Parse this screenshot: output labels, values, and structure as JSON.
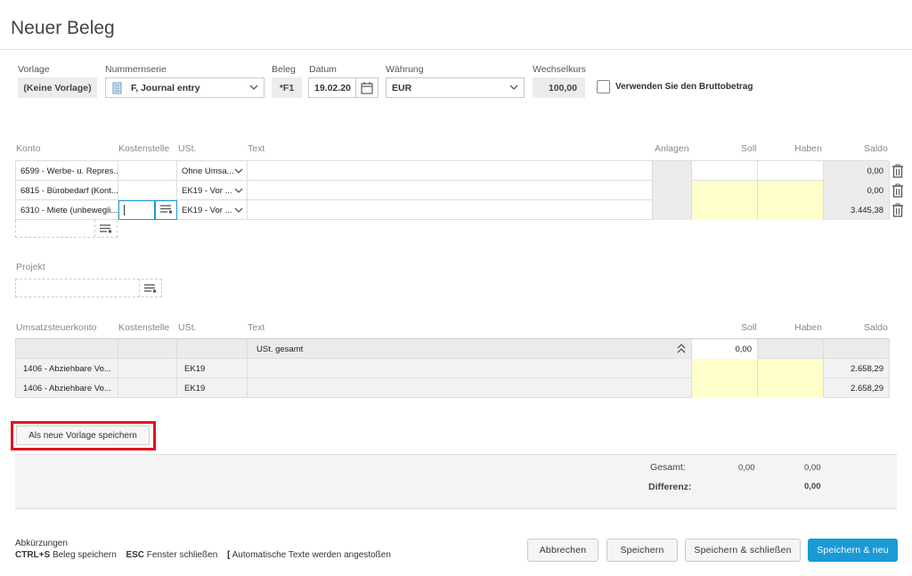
{
  "page": {
    "title": "Neuer Beleg"
  },
  "header": {
    "vorlage_label": "Vorlage",
    "vorlage_value": "(Keine Vorlage)",
    "nummernserie_label": "Nummernserie",
    "nummernserie_value": "F, Journal entry",
    "beleg_label": "Beleg",
    "beleg_value": "*F1",
    "datum_label": "Datum",
    "datum_value": "19.02.20",
    "waehrung_label": "Währung",
    "waehrung_value": "EUR",
    "wechselkurs_label": "Wechselkurs",
    "wechselkurs_value": "100,00",
    "brutto_label": "Verwenden Sie den Bruttobetrag"
  },
  "lines": {
    "columns": {
      "konto": "Konto",
      "kostenstelle": "Kostenstelle",
      "ust": "USt.",
      "text": "Text",
      "anlagen": "Anlagen",
      "soll": "Soll",
      "haben": "Haben",
      "saldo": "Saldo"
    },
    "rows": [
      {
        "konto": "6599 - Werbe- u. Repres...",
        "ust": "Ohne Umsa...",
        "saldo": "0,00"
      },
      {
        "konto": "6815 - Bürobedarf (Kont...",
        "ust": "EK19 - Vor ...",
        "saldo": "0,00"
      },
      {
        "konto": "6310 - Miete (unbewegli...",
        "ust": "EK19 - Vor ...",
        "saldo": "3.445,38"
      }
    ]
  },
  "projekt": {
    "label": "Projekt"
  },
  "tax": {
    "columns": {
      "konto": "Umsatzsteuerkonto",
      "kostenstelle": "Kostenstelle",
      "ust": "USt.",
      "text": "Text",
      "soll": "Soll",
      "haben": "Haben",
      "saldo": "Saldo"
    },
    "summary": {
      "text": "USt. gesamt",
      "soll": "0,00"
    },
    "rows": [
      {
        "konto": "1406 - Abziehbare Vo...",
        "ust": "EK19",
        "saldo": "2.658,29"
      },
      {
        "konto": "1406 - Abziehbare Vo...",
        "ust": "EK19",
        "saldo": "2.658,29"
      }
    ]
  },
  "save_template_label": "Als neue Vorlage speichern",
  "totals": {
    "gesamt_label": "Gesamt:",
    "gesamt_soll": "0,00",
    "gesamt_haben": "0,00",
    "differenz_label": "Differenz:",
    "differenz_value": "0,00"
  },
  "footer": {
    "abk_title": "Abkürzungen",
    "shortcut1_key": "CTRL+S",
    "shortcut1_text": "Beleg speichern",
    "shortcut2_key": "ESC",
    "shortcut2_text": "Fenster schließen",
    "shortcut3_key": "[",
    "shortcut3_text": "Automatische Texte werden angestoßen"
  },
  "buttons": {
    "cancel": "Abbrechen",
    "save": "Speichern",
    "save_close": "Speichern & schließen",
    "save_new": "Speichern & neu"
  },
  "colors": {
    "accent": "#1b9ad6",
    "highlight_red": "#e0141e",
    "yellow_cell": "#ffffcc"
  }
}
